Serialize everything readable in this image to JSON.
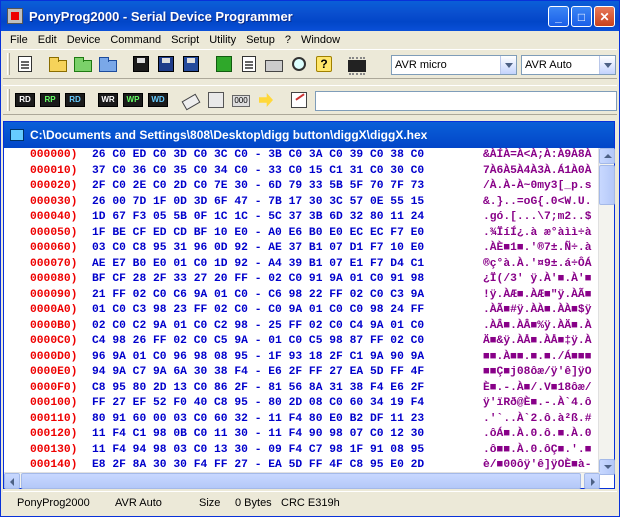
{
  "window": {
    "title": "PonyProg2000 - Serial Device Programmer"
  },
  "menu": [
    "File",
    "Edit",
    "Device",
    "Command",
    "Script",
    "Utility",
    "Setup",
    "?",
    "Window"
  ],
  "toolbar": {
    "device_family": "AVR micro",
    "device_type": "AVR Auto",
    "address_field": ""
  },
  "document": {
    "title": "C:\\Documents and Settings\\808\\Desktop\\digg button\\diggX\\diggX.hex",
    "rows": [
      {
        "addr": "000000)",
        "bytes": "26 C0 ED C0 3D C0 3C C0 - 3B C0 3A C0 39 C0 38 C0",
        "ascii": "&ÀÍÀ=À<À;À:À9À8À"
      },
      {
        "addr": "000010)",
        "bytes": "37 C0 36 C0 35 C0 34 C0 - 33 C0 15 C1 31 C0 30 C0",
        "ascii": "7À6À5À4À3À.Á1À0À"
      },
      {
        "addr": "000020)",
        "bytes": "2F C0 2E C0 2D C0 7E 30 - 6D 79 33 5B 5F 70 7F 73",
        "ascii": "/À.À-À~0my3[_p.s"
      },
      {
        "addr": "000030)",
        "bytes": "26 00 7D 1F 0D 3D 6F 47 - 7B 17 30 3C 57 0E 55 15",
        "ascii": "&.}..=oG{.0<W.U."
      },
      {
        "addr": "000040)",
        "bytes": "1D 67 F3 05 5B 0F 1C 1C - 5C 37 3B 6D 32 80 11 24",
        "ascii": ".gó.[...\\7;m2..$"
      },
      {
        "addr": "000050)",
        "bytes": "1F BE CF ED CD BF 10 E0 - A0 E6 B0 E0 EC EC F7 E0",
        "ascii": ".¾ÏíÍ¿.à æ°àìì÷à"
      },
      {
        "addr": "000060)",
        "bytes": "03 C0 C8 95 31 96 0D 92 - AE 37 B1 07 D1 F7 10 E0",
        "ascii": ".ÀÈ■1■.'®7±.Ñ÷.à"
      },
      {
        "addr": "000070)",
        "bytes": "AE E7 B0 E0 01 C0 1D 92 - A4 39 B1 07 E1 F7 D4 C1",
        "ascii": "®ç°à.À.'¤9±.á÷ÔÁ"
      },
      {
        "addr": "000080)",
        "bytes": "BF CF 28 2F 33 27 20 FF - 02 C0 91 9A 01 C0 91 98",
        "ascii": "¿Ï(/3' ÿ.À'■.À'■"
      },
      {
        "addr": "000090)",
        "bytes": "21 FF 02 C0 C6 9A 01 C0 - C6 98 22 FF 02 C0 C3 9A",
        "ascii": "!ÿ.ÀÆ■.ÀÆ■\"ÿ.ÀÃ■"
      },
      {
        "addr": "0000A0)",
        "bytes": "01 C0 C3 98 23 FF 02 C0 - C0 9A 01 C0 C0 98 24 FF",
        "ascii": ".ÀÃ■#ÿ.ÀÀ■.ÀÀ■$ÿ"
      },
      {
        "addr": "0000B0)",
        "bytes": "02 C0 C2 9A 01 C0 C2 98 - 25 FF 02 C0 C4 9A 01 C0",
        "ascii": ".ÀÂ■.ÀÂ■%ÿ.ÀÄ■.À"
      },
      {
        "addr": "0000C0)",
        "bytes": "C4 98 26 FF 02 C0 C5 9A - 01 C0 C5 98 87 FF 02 C0",
        "ascii": "Ä■&ÿ.ÀÅ■.ÀÅ■‡ÿ.À"
      },
      {
        "addr": "0000D0)",
        "bytes": "96 9A 01 C0 96 98 08 95 - 1F 93 18 2F C1 9A 90 9A",
        "ascii": "■■.À■■.■.■./Á■■■"
      },
      {
        "addr": "0000E0)",
        "bytes": "94 9A C7 9A 6A 30 38 F4 - E6 2F FF 27 EA 5D FF 4F",
        "ascii": "■■Ç■j08ôæ/ÿ'ê]ÿO"
      },
      {
        "addr": "0000F0)",
        "bytes": "C8 95 80 2D 13 C0 86 2F - 81 56 8A 31 38 F4 E6 2F",
        "ascii": "È■.-.À■/.V■18ôæ/"
      },
      {
        "addr": "000100)",
        "bytes": "FF 27 EF 52 F0 40 C8 95 - 80 2D 08 C0 60 34 19 F4",
        "ascii": "ÿ'ïRð@È■.-.À`4.ô"
      },
      {
        "addr": "000110)",
        "bytes": "80 91 60 00 03 C0 60 32 - 11 F4 80 E0 B2 DF 11 23",
        "ascii": ".'`..À`2.ô.à²ß.#"
      },
      {
        "addr": "000120)",
        "bytes": "11 F4 C1 98 0B C0 11 30 - 11 F4 90 98 07 C0 12 30",
        "ascii": ".ôÁ■.À.0.ô.■.À.0"
      },
      {
        "addr": "000130)",
        "bytes": "11 F4 94 98 03 C0 13 30 - 09 F4 C7 98 1F 91 08 95",
        "ascii": ".ô■■.À.0.ôÇ■.'.■"
      },
      {
        "addr": "000140)",
        "bytes": "E8 2F 8A 30 30 F4 FF 27 - EA 5D FF 4F C8 95 E0 2D",
        "ascii": "è/■00ôÿ'ê]ÿOÈ■à-"
      },
      {
        "addr": "000150)",
        "bytes": "10 C0 81 56 8A 31 30 F4 - FF 27 EF 52 F0 40 C8 95",
        "ascii": ".À.V■10ôÿ'ïRð@È■"
      }
    ]
  },
  "status": {
    "app": "PonyProg2000",
    "device": "AVR  Auto",
    "size_label": "Size",
    "size_value": "0 Bytes",
    "crc": "CRC  E319h"
  }
}
